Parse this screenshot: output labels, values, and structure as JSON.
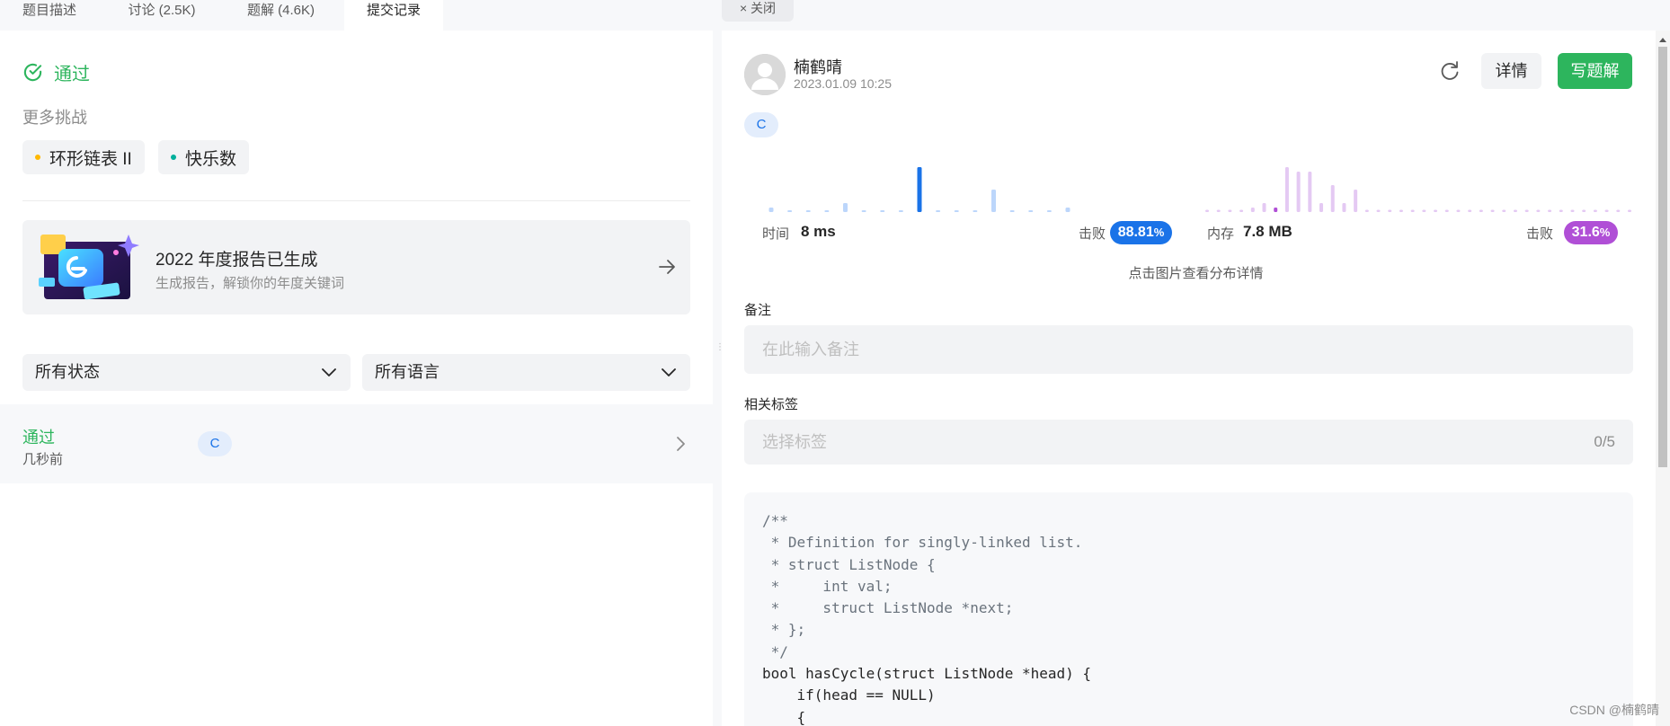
{
  "tabs": [
    {
      "label": "题目描述"
    },
    {
      "label": "讨论 (2.5K)"
    },
    {
      "label": "题解 (4.6K)"
    },
    {
      "label": "提交记录"
    }
  ],
  "status": {
    "label": "通过",
    "color": "#2db55d"
  },
  "more_challenges": {
    "label": "更多挑战",
    "items": [
      {
        "label": "环形链表 II",
        "dot_color": "#ffb800"
      },
      {
        "label": "快乐数",
        "dot_color": "#00af9b"
      }
    ]
  },
  "report": {
    "title": "2022 年度报告已生成",
    "subtitle": "生成报告，解锁你的年度关键词"
  },
  "filters": {
    "status": "所有状态",
    "language": "所有语言"
  },
  "submission": {
    "status": "通过",
    "time": "几秒前",
    "lang": "C"
  },
  "close_label": "关闭",
  "user": {
    "name": "楠鹤晴",
    "time": "2023.01.09 10:25"
  },
  "buttons": {
    "detail": "详情",
    "write_solution": "写题解"
  },
  "lang_badge": "C",
  "runtime": {
    "label": "时间",
    "value": "8 ms",
    "beats_label": "击败",
    "beats_main": "88.81",
    "beats_pct": "%",
    "color": "#1a73e8",
    "distribution": [
      1,
      0,
      0,
      0,
      2,
      0,
      0,
      0,
      10,
      0,
      0,
      0,
      5,
      0,
      0,
      0,
      1
    ]
  },
  "memory": {
    "label": "内存",
    "value": "7.8 MB",
    "beats_label": "击败",
    "beats_main": "31.6",
    "beats_pct": "%",
    "color": "#b04fd6",
    "distribution": [
      0.5,
      0.5,
      0.5,
      0.5,
      1,
      2,
      1,
      10,
      9,
      9,
      2,
      6,
      2,
      5,
      0.5,
      0.5,
      0.5,
      0.5,
      0.5,
      0.5,
      0.5,
      0.5,
      0.5,
      0.5,
      0.5,
      0.5,
      0.5,
      0.5,
      0.5,
      0.5,
      0.5,
      0.5,
      0.5,
      0.5,
      0.5,
      0.5,
      0.5,
      0.5
    ],
    "highlight_index": 6
  },
  "chart_hint": "点击图片查看分布详情",
  "note": {
    "label": "备注",
    "placeholder": "在此输入备注"
  },
  "tags": {
    "label": "相关标签",
    "placeholder": "选择标签",
    "count": "0/5"
  },
  "code_lines": [
    "/**",
    " * Definition for singly-linked list.",
    " * struct ListNode {",
    " *     int val;",
    " *     struct ListNode *next;",
    " * };",
    " */",
    "bool hasCycle(struct ListNode *head) {",
    "    if(head == NULL)",
    "    {"
  ],
  "watermark": "CSDN @楠鹤晴"
}
